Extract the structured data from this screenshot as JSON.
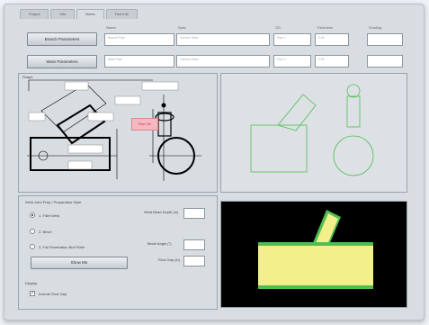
{
  "tabs": [
    "Project",
    "Info",
    "Notes",
    "Fwd Info"
  ],
  "active_tab_index": 2,
  "buttons": {
    "top_1": "Branch Parameters",
    "top_2": "Wear Parameters",
    "run": "Show Me"
  },
  "columns": [
    "Name",
    "Spec",
    "OD",
    "Thickness",
    "Grading"
  ],
  "rows": [
    {
      "name": "Branch Pipe",
      "spec": "Carbon Steel",
      "od": "Pipe 1",
      "thickness": "0.51",
      "grading": ""
    },
    {
      "name": "Main Pipe",
      "spec": "Carbon Steel",
      "od": "Pipe 2",
      "thickness": "0.51",
      "grading": ""
    }
  ],
  "diagram": {
    "section_label": "Shape",
    "tag": "Run OK"
  },
  "options": {
    "group_label": "Weld Joint Prep / Preparation Style",
    "radios": [
      "1. Fillet Weld",
      "2. Bevel",
      "3. Full Penetration Butt Plate"
    ],
    "selected_index": 0,
    "depth_label": "Weld Bead Depth (in)",
    "angle_label": "Bevel Angle (°)",
    "gap_label": "Root Gap (in)",
    "depth_value": "",
    "angle_value": "",
    "gap_value": "",
    "footer_label": "Display",
    "checkbox_label": "Include Root Gap",
    "checkbox_checked": true
  },
  "colors": {
    "outline": "#000000",
    "green": "#4fbf53",
    "yellow": "#f3ef8a",
    "pink": "#f4b8c2",
    "render_bg": "#000000"
  }
}
